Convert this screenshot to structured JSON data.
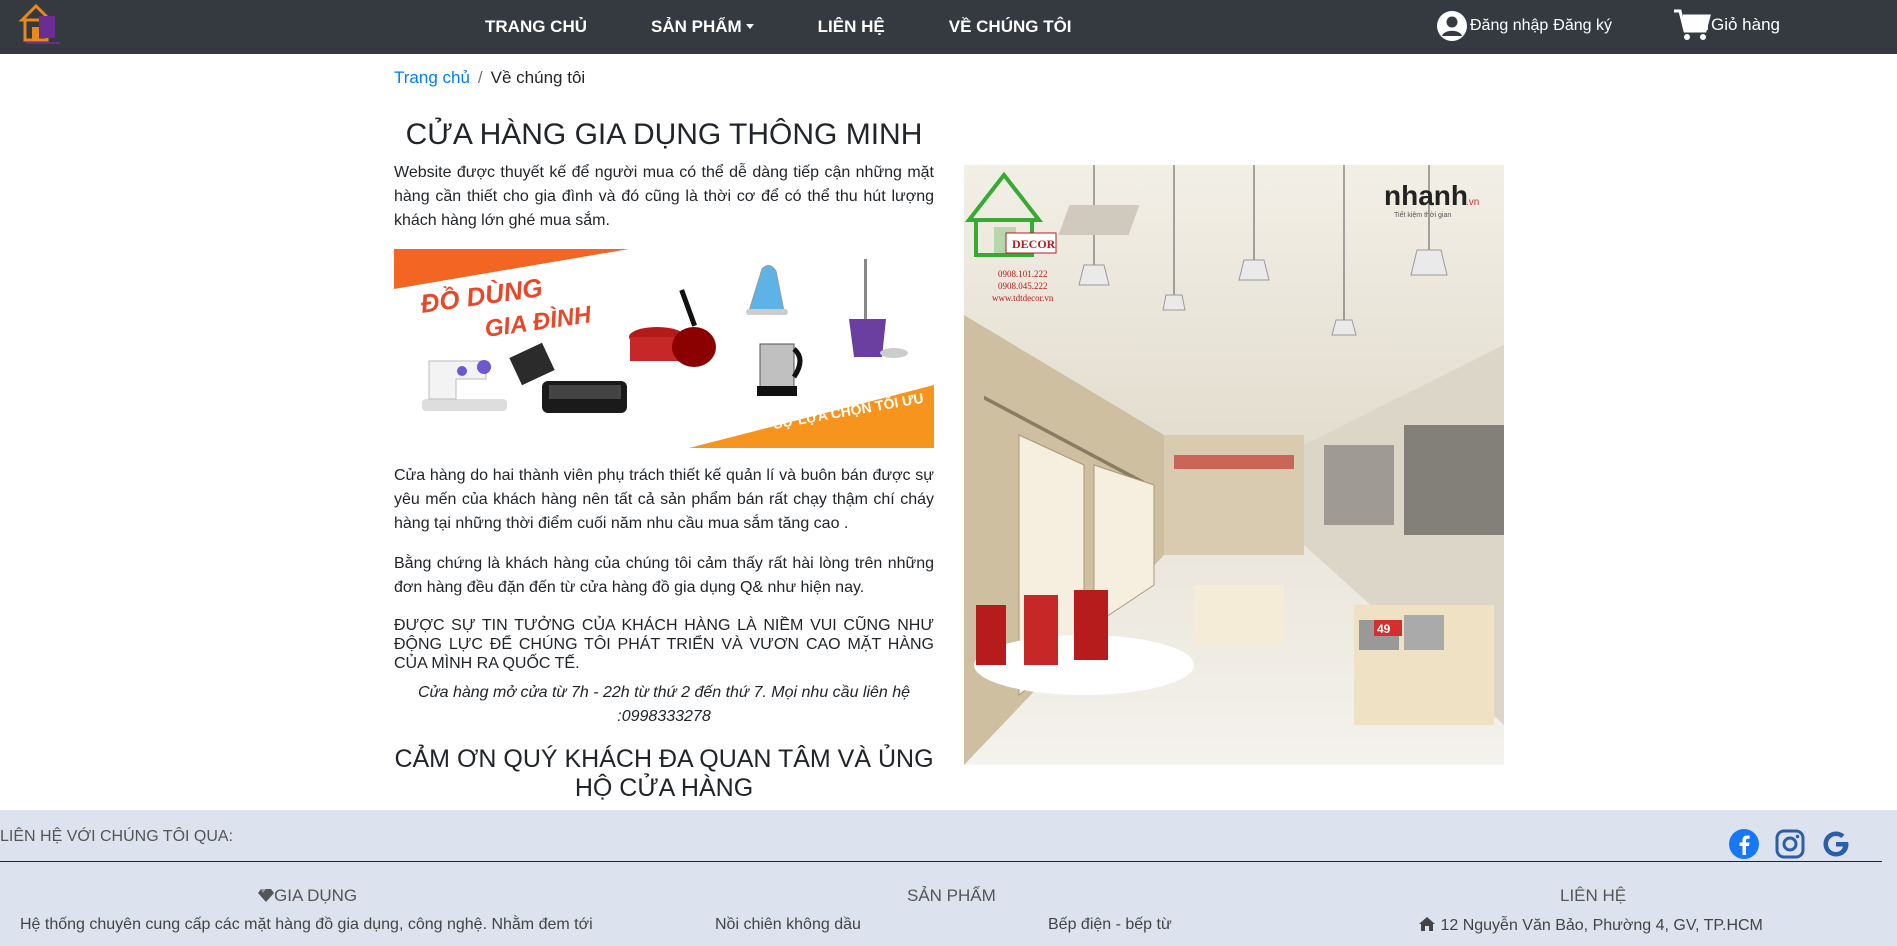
{
  "nav": {
    "links": [
      "TRANG CHỦ",
      "SẢN PHẨM",
      "LIÊN HỆ",
      "VỀ CHÚNG TÔI"
    ],
    "login_label": "Đăng nhập",
    "register_label": "Đăng ký",
    "cart_label": "Giỏ hàng"
  },
  "breadcrumb": {
    "home": "Trang chủ",
    "separator": "/",
    "current": "Về chúng tôi"
  },
  "main": {
    "title": "CỬA HÀNG GIA DỤNG THÔNG MINH",
    "intro": "Website được thuyết kế để người mua có thể dễ dàng tiếp cận những mặt hàng cần thiết cho gia đình và đó cũng là thời cơ để có thể thu hút lượng khách hàng lớn ghé mua sắm.",
    "banner": {
      "heading_line1": "ĐỒ DÙNG",
      "heading_line2": "GIA ĐÌNH",
      "slogan": "SỰ LỰA CHỌN TỐI ƯU"
    },
    "para2": "Cửa hàng do hai thành viên phụ trách thiết kế quản lí và buôn bán được sự yêu mến của khách hàng nên tất cả sản phẩm bán rất chạy thậm chí cháy hàng tại những thời điểm cuối năm nhu cầu mua sắm tăng cao .",
    "para3": "Bằng chứng là khách hàng của chúng tôi cảm thấy rất hài lòng trên những đơn hàng đều đặn đến từ cửa hàng đồ gia dụng Q& như hiện nay.",
    "para4": "ĐƯỢC SỰ TIN TƯỞNG CỦA KHÁCH HÀNG LÀ NIỀM VUI CŨNG NHƯ ĐỘNG LỰC ĐỂ CHÚNG TÔI PHÁT TRIỂN VÀ VƯƠN CAO MẶT HÀNG CỦA MÌNH RA QUỐC TẾ.",
    "hours_line1": "Cửa hàng mở cửa từ 7h - 22h từ thứ 2 đến thứ 7. Mọi nhu cầu liên hệ",
    "hours_line2": ":0998333278",
    "thanks_line1": "CẢM ƠN QUÝ KHÁCH ĐA QUAN TÂM VÀ ỦNG",
    "thanks_line2": "HỘ CỬA HÀNG",
    "store_photo": {
      "logo_text": "DECOR",
      "phone1": "0908.101.222",
      "phone2": "0908.045.222",
      "website": "www.tdtdecor.vn",
      "watermark": "nhanh",
      "watermark_suffix": ".vn",
      "watermark_tagline": "Tiết kiệm thời gian",
      "price_tag": "49"
    }
  },
  "footer": {
    "contact_label": "LIÊN HỆ VỚI CHÚNG TÔI QUA:",
    "col1_title": "GIA DỤNG",
    "col1_text": "Hệ thống chuyên cung cấp các mặt hàng đồ gia dụng, công nghệ. Nhằm đem tới",
    "col2_title": "SẢN PHẨM",
    "col2_item1": "Nồi chiên không dầu",
    "col2_item2": "Bếp điện - bếp từ",
    "col3_title": "LIÊN HỆ",
    "col3_address": "12 Nguyễn Văn Bảo, Phường 4, GV, TP.HCM"
  },
  "colors": {
    "navbar": "#343a40",
    "link": "#007bff",
    "footer_bg": "#dde3ee",
    "banner_orange": "#f26522",
    "facebook": "#1877f2",
    "instagram": "#2b5ea8",
    "google": "#2b5ea8"
  },
  "icons": [
    "logo-icon",
    "user-icon",
    "cart-icon",
    "facebook-icon",
    "instagram-icon",
    "google-icon",
    "diamond-icon",
    "home-icon"
  ]
}
